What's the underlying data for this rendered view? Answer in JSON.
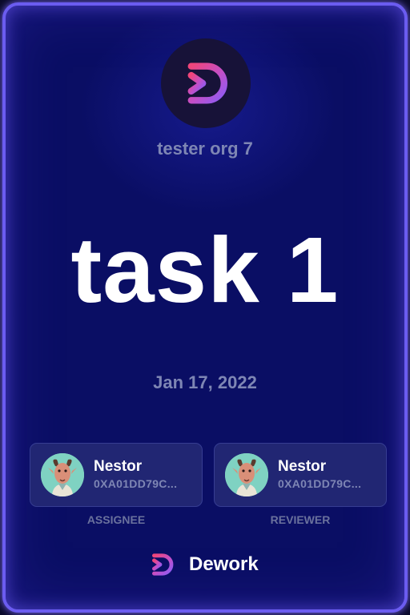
{
  "org": {
    "name": "tester org 7",
    "logo_icon": "dework-logo-icon"
  },
  "task": {
    "title": "task 1",
    "date": "Jan 17, 2022"
  },
  "assignee": {
    "name": "Nestor",
    "address": "0XA01DD79C...",
    "role_label": "ASSIGNEE",
    "avatar_icon": "goat-avatar-icon"
  },
  "reviewer": {
    "name": "Nestor",
    "address": "0XA01DD79C...",
    "role_label": "REVIEWER",
    "avatar_icon": "goat-avatar-icon"
  },
  "brand": {
    "name": "Dework",
    "logo_icon": "dework-logo-icon"
  },
  "colors": {
    "background": "#0a0e64",
    "border": "#6b5cf0",
    "muted_text": "#7e86b4",
    "card": "#212673",
    "logo_pink": "#f0457a",
    "logo_purple": "#8a5cf6"
  }
}
